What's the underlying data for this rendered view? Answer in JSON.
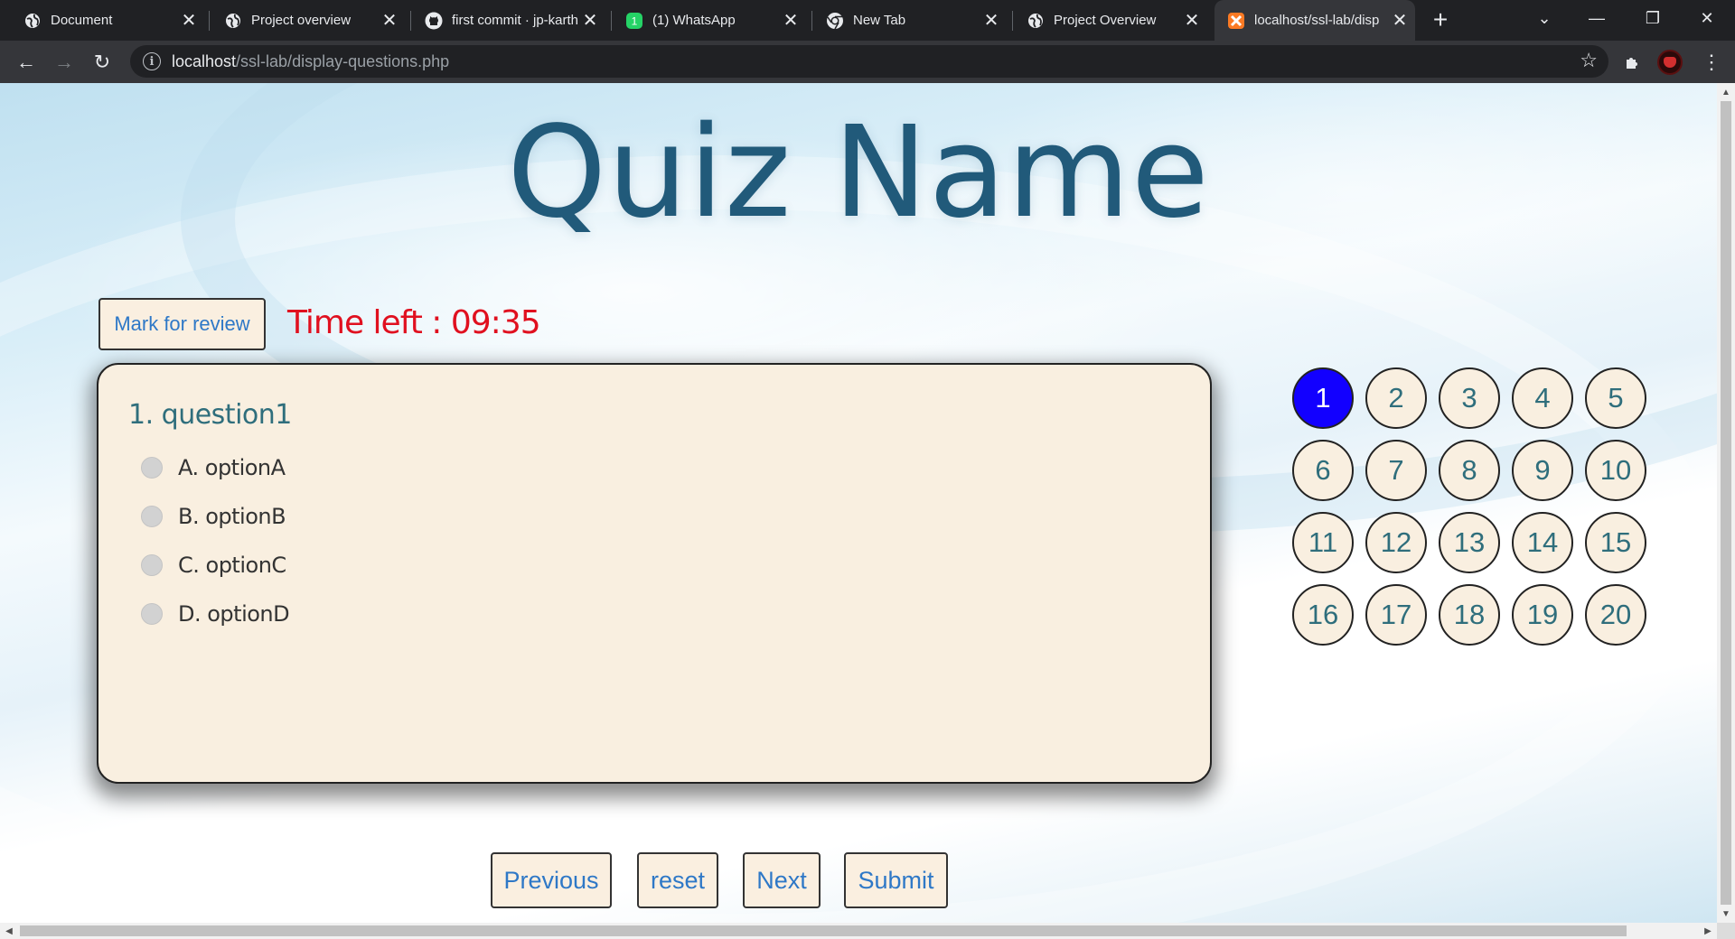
{
  "browser": {
    "tabs": [
      {
        "title": "Document",
        "icon": "globe-icon"
      },
      {
        "title": "Project overview",
        "icon": "globe-icon"
      },
      {
        "title": "first commit · jp-karth",
        "icon": "github-icon"
      },
      {
        "title": "(1) WhatsApp",
        "icon": "whatsapp-icon",
        "badge": "1"
      },
      {
        "title": "New Tab",
        "icon": "chrome-icon"
      },
      {
        "title": "Project Overview",
        "icon": "globe-icon"
      },
      {
        "title": "localhost/ssl-lab/disp",
        "icon": "xampp-icon",
        "active": true
      }
    ],
    "new_tab_label": "+",
    "url_host": "localhost",
    "url_path": "/ssl-lab/display-questions.php"
  },
  "quiz": {
    "title": "Quiz Name",
    "mark_for_review_label": "Mark for review",
    "timer_label": "Time left : ",
    "timer_value": "09:35",
    "question": {
      "text": "1. question1",
      "options": [
        "A. optionA",
        "B. optionB",
        "C. optionC",
        "D. optionD"
      ],
      "selected": null
    },
    "palette": {
      "current": "1",
      "numbers": [
        "1",
        "2",
        "3",
        "4",
        "5",
        "6",
        "7",
        "8",
        "9",
        "10",
        "11",
        "12",
        "13",
        "14",
        "15",
        "16",
        "17",
        "18",
        "19",
        "20"
      ]
    },
    "nav": {
      "previous_label": "Previous",
      "reset_label": "reset",
      "next_label": "Next",
      "submit_label": "Submit"
    }
  },
  "colors": {
    "title": "#215a7a",
    "timer": "#e0101f",
    "card_bg": "#f9efe0",
    "current_question": "#1200ff",
    "button_text": "#2e78c7"
  }
}
